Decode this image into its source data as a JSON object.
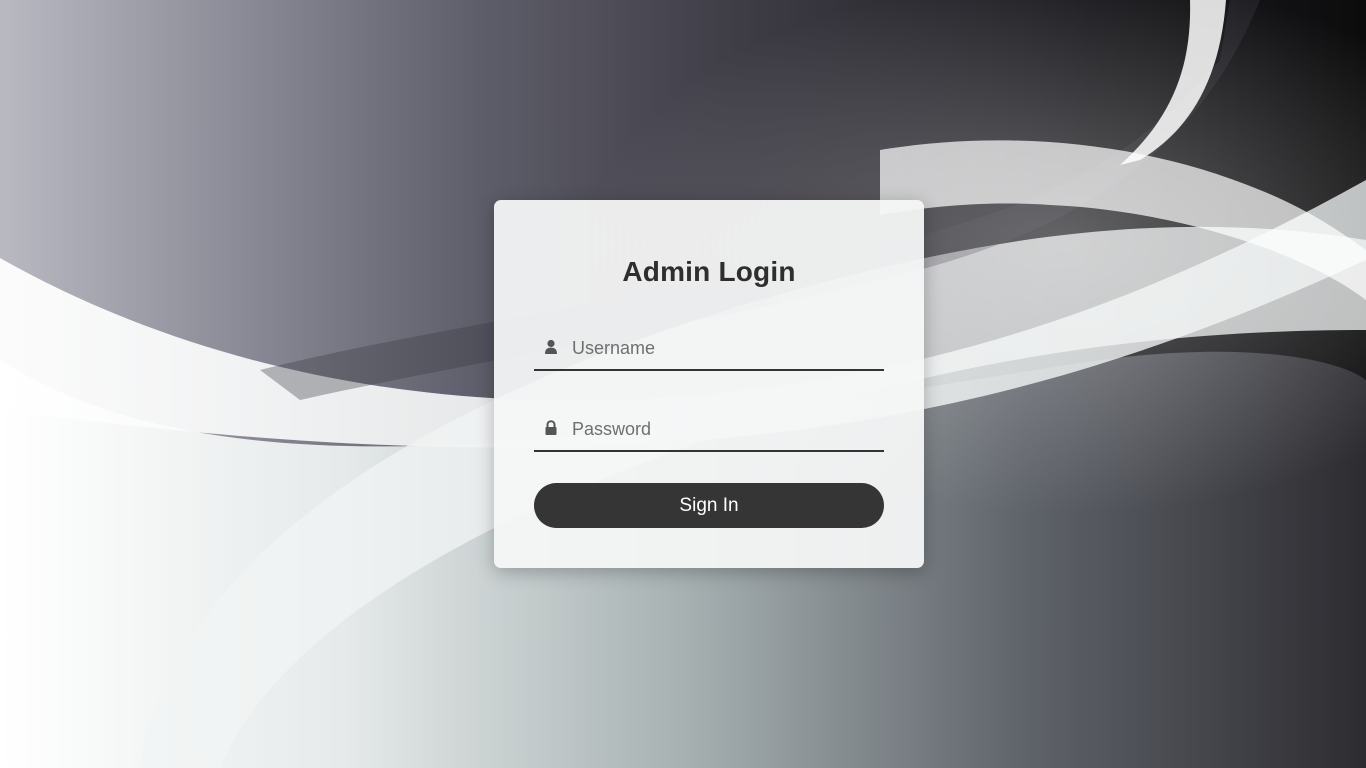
{
  "login": {
    "title": "Admin Login",
    "username": {
      "placeholder": "Username",
      "value": "",
      "icon": "user-icon"
    },
    "password": {
      "placeholder": "Password",
      "value": "",
      "icon": "lock-icon"
    },
    "submit_label": "Sign In"
  },
  "colors": {
    "card_bg": "#f5f6f6",
    "button_bg": "#353535",
    "button_text": "#ffffff",
    "title_text": "#2e2e2e",
    "underline": "#333333"
  }
}
